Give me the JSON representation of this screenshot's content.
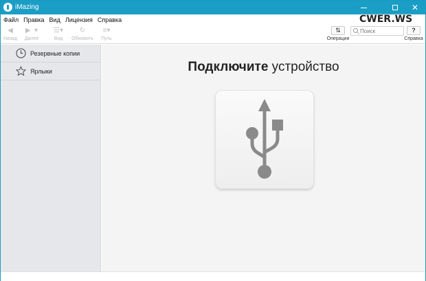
{
  "window": {
    "title": "iMazing"
  },
  "watermark": "CWER.WS",
  "menu": [
    "Файл",
    "Правка",
    "Вид",
    "Лицензия",
    "Справка"
  ],
  "toolbar": {
    "back_label": "Назад",
    "forward_label": "Далее",
    "view_label": "Вид",
    "refresh_label": "Обновить",
    "path_label": "Путь",
    "operations_label": "Операции",
    "help_label": "Справка"
  },
  "search": {
    "placeholder": "Поиск"
  },
  "sidebar": {
    "items": [
      {
        "label": "Резервные копии",
        "icon": "clock-icon"
      },
      {
        "label": "Ярлыки",
        "icon": "star-icon"
      }
    ]
  },
  "main": {
    "headline_bold": "Подключите",
    "headline_rest": " устройство",
    "image_icon": "usb-icon"
  },
  "colors": {
    "titlebar": "#1b9ec5",
    "sidebar": "#e6e7ea",
    "main_bg": "#f4f4f4",
    "usb_glyph": "#8a8a8a"
  }
}
